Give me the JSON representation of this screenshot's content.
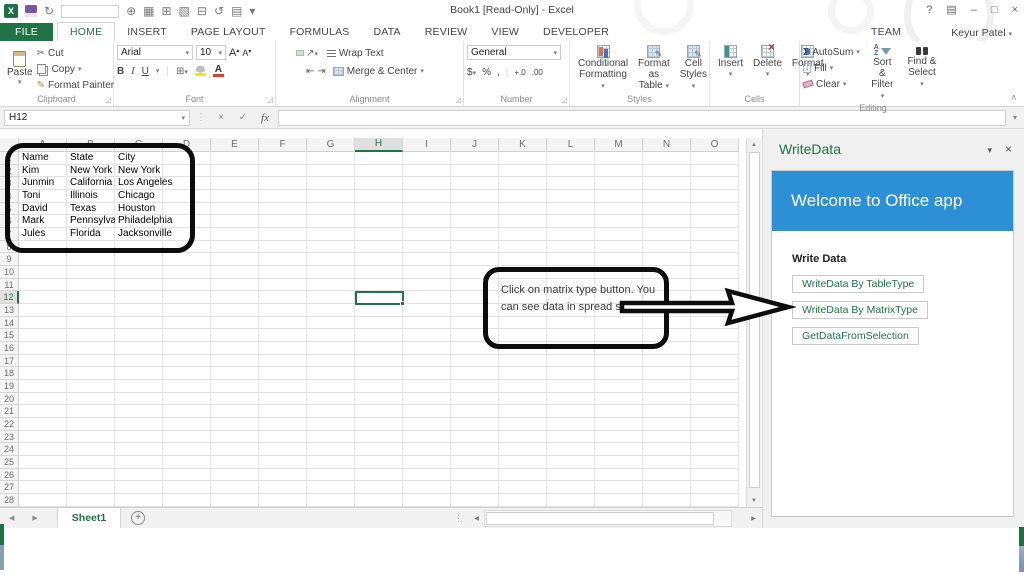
{
  "titlebar": {
    "title": "Book1 [Read-Only] - Excel",
    "user": "Keyur Patel",
    "controls": [
      {
        "name": "help-icon",
        "glyph": "?"
      },
      {
        "name": "ribbon-display-options-icon",
        "glyph": "▤"
      },
      {
        "name": "minimize-icon",
        "glyph": "–"
      },
      {
        "name": "restore-icon",
        "glyph": "□"
      },
      {
        "name": "close-icon",
        "glyph": "×"
      }
    ],
    "qat": [
      {
        "name": "excel-logo",
        "glyph": "X"
      },
      {
        "name": "save-icon",
        "glyph": ""
      },
      {
        "name": "redo-icon",
        "glyph": "↻"
      },
      {
        "name": "quick-input",
        "glyph": ""
      },
      {
        "name": "navigate-icon",
        "glyph": "⊕"
      },
      {
        "name": "edit-table-icon",
        "glyph": "▦"
      },
      {
        "name": "table-icon",
        "glyph": "⊞"
      },
      {
        "name": "design-mode-icon",
        "glyph": "▧"
      },
      {
        "name": "send-sheet-icon",
        "glyph": "⊟"
      },
      {
        "name": "undo-icon",
        "glyph": "↺"
      },
      {
        "name": "toolbox-icon",
        "glyph": "▤"
      },
      {
        "name": "qat-more-icon",
        "glyph": "▾"
      }
    ]
  },
  "tabs": {
    "items": [
      "FILE",
      "HOME",
      "INSERT",
      "PAGE LAYOUT",
      "FORMULAS",
      "DATA",
      "REVIEW",
      "VIEW",
      "DEVELOPER",
      "TEAM"
    ],
    "active": "HOME"
  },
  "ribbon": {
    "clipboard": {
      "label": "Clipboard",
      "paste": "Paste",
      "cut": "Cut",
      "copy": "Copy",
      "painter": "Format Painter"
    },
    "font": {
      "label": "Font",
      "family": "Arial",
      "size": "10",
      "bold": "B",
      "italic": "I",
      "underline": "U",
      "grow": "A",
      "shrink": "A"
    },
    "alignment": {
      "label": "Alignment",
      "wrap": "Wrap Text",
      "merge": "Merge & Center"
    },
    "number": {
      "label": "Number",
      "format": "General",
      "dollar": "$",
      "percent": "%",
      "comma": ",",
      "inc_decimal": "+.0",
      "dec_decimal": ".00"
    },
    "styles": {
      "label": "Styles",
      "cf1": "Conditional",
      "cf2": "Formatting",
      "fat1": "Format as",
      "fat2": "Table",
      "cs1": "Cell",
      "cs2": "Styles"
    },
    "cells": {
      "label": "Cells",
      "insert": "Insert",
      "delete": "Delete",
      "format": "Format"
    },
    "editing": {
      "label": "Editing",
      "autosum": "AutoSum",
      "fill": "Fill",
      "clear": "Clear",
      "sf1": "Sort &",
      "sf2": "Filter",
      "fs1": "Find &",
      "fs2": "Select"
    }
  },
  "formula_bar": {
    "name_box": "H12",
    "fx": "fx",
    "value": ""
  },
  "grid": {
    "columns": [
      "A",
      "B",
      "C",
      "D",
      "E",
      "F",
      "G",
      "H",
      "I",
      "J",
      "K",
      "L",
      "M",
      "N",
      "O"
    ],
    "selected_column": "H",
    "row_count": 28,
    "selected_row": 12,
    "selected_cell": "H12",
    "cells": [
      [
        "Name",
        "State",
        "City"
      ],
      [
        "Kim",
        "New York",
        "New York"
      ],
      [
        "Junmin",
        "California",
        "Los Angeles"
      ],
      [
        "Toni",
        "Illinois",
        "Chicago"
      ],
      [
        "David",
        "Texas",
        "Houston"
      ],
      [
        "Mark",
        "Pennsylvania",
        "Philadelphia"
      ],
      [
        "Jules",
        "Florida",
        "Jacksonville"
      ]
    ]
  },
  "annotations": {
    "note": "Click on matrix type button. You can see data in spread sheet."
  },
  "taskpane": {
    "title": "WriteData",
    "banner": "Welcome to Office app",
    "section": "Write Data",
    "buttons": [
      "WriteData By TableType",
      "WriteData By MatrixType",
      "GetDataFromSelection"
    ]
  },
  "sheetbar": {
    "active_tab": "Sheet1",
    "add": "+"
  },
  "icons": {
    "dropdown": "▾",
    "launcher": "◿",
    "cut": "✂",
    "painter": "✎",
    "sigma": "Σ",
    "fill_arrow": "↓",
    "check": "✓",
    "cancel": "×",
    "up": "▲",
    "down": "▼",
    "left": "◀",
    "right": "▶",
    "orientation": "↗",
    "indent_dec": "⇤",
    "indent_inc": "⇥",
    "borders": "⊞",
    "ellipsis_v": "⋮",
    "collapse": "ᴧ",
    "az_a": "A",
    "az_z": "Z",
    "pencil": "✎"
  },
  "colors": {
    "excel_green": "#217346",
    "banner_blue": "#2d8fd6",
    "annotation_black": "#0d0d0d"
  }
}
